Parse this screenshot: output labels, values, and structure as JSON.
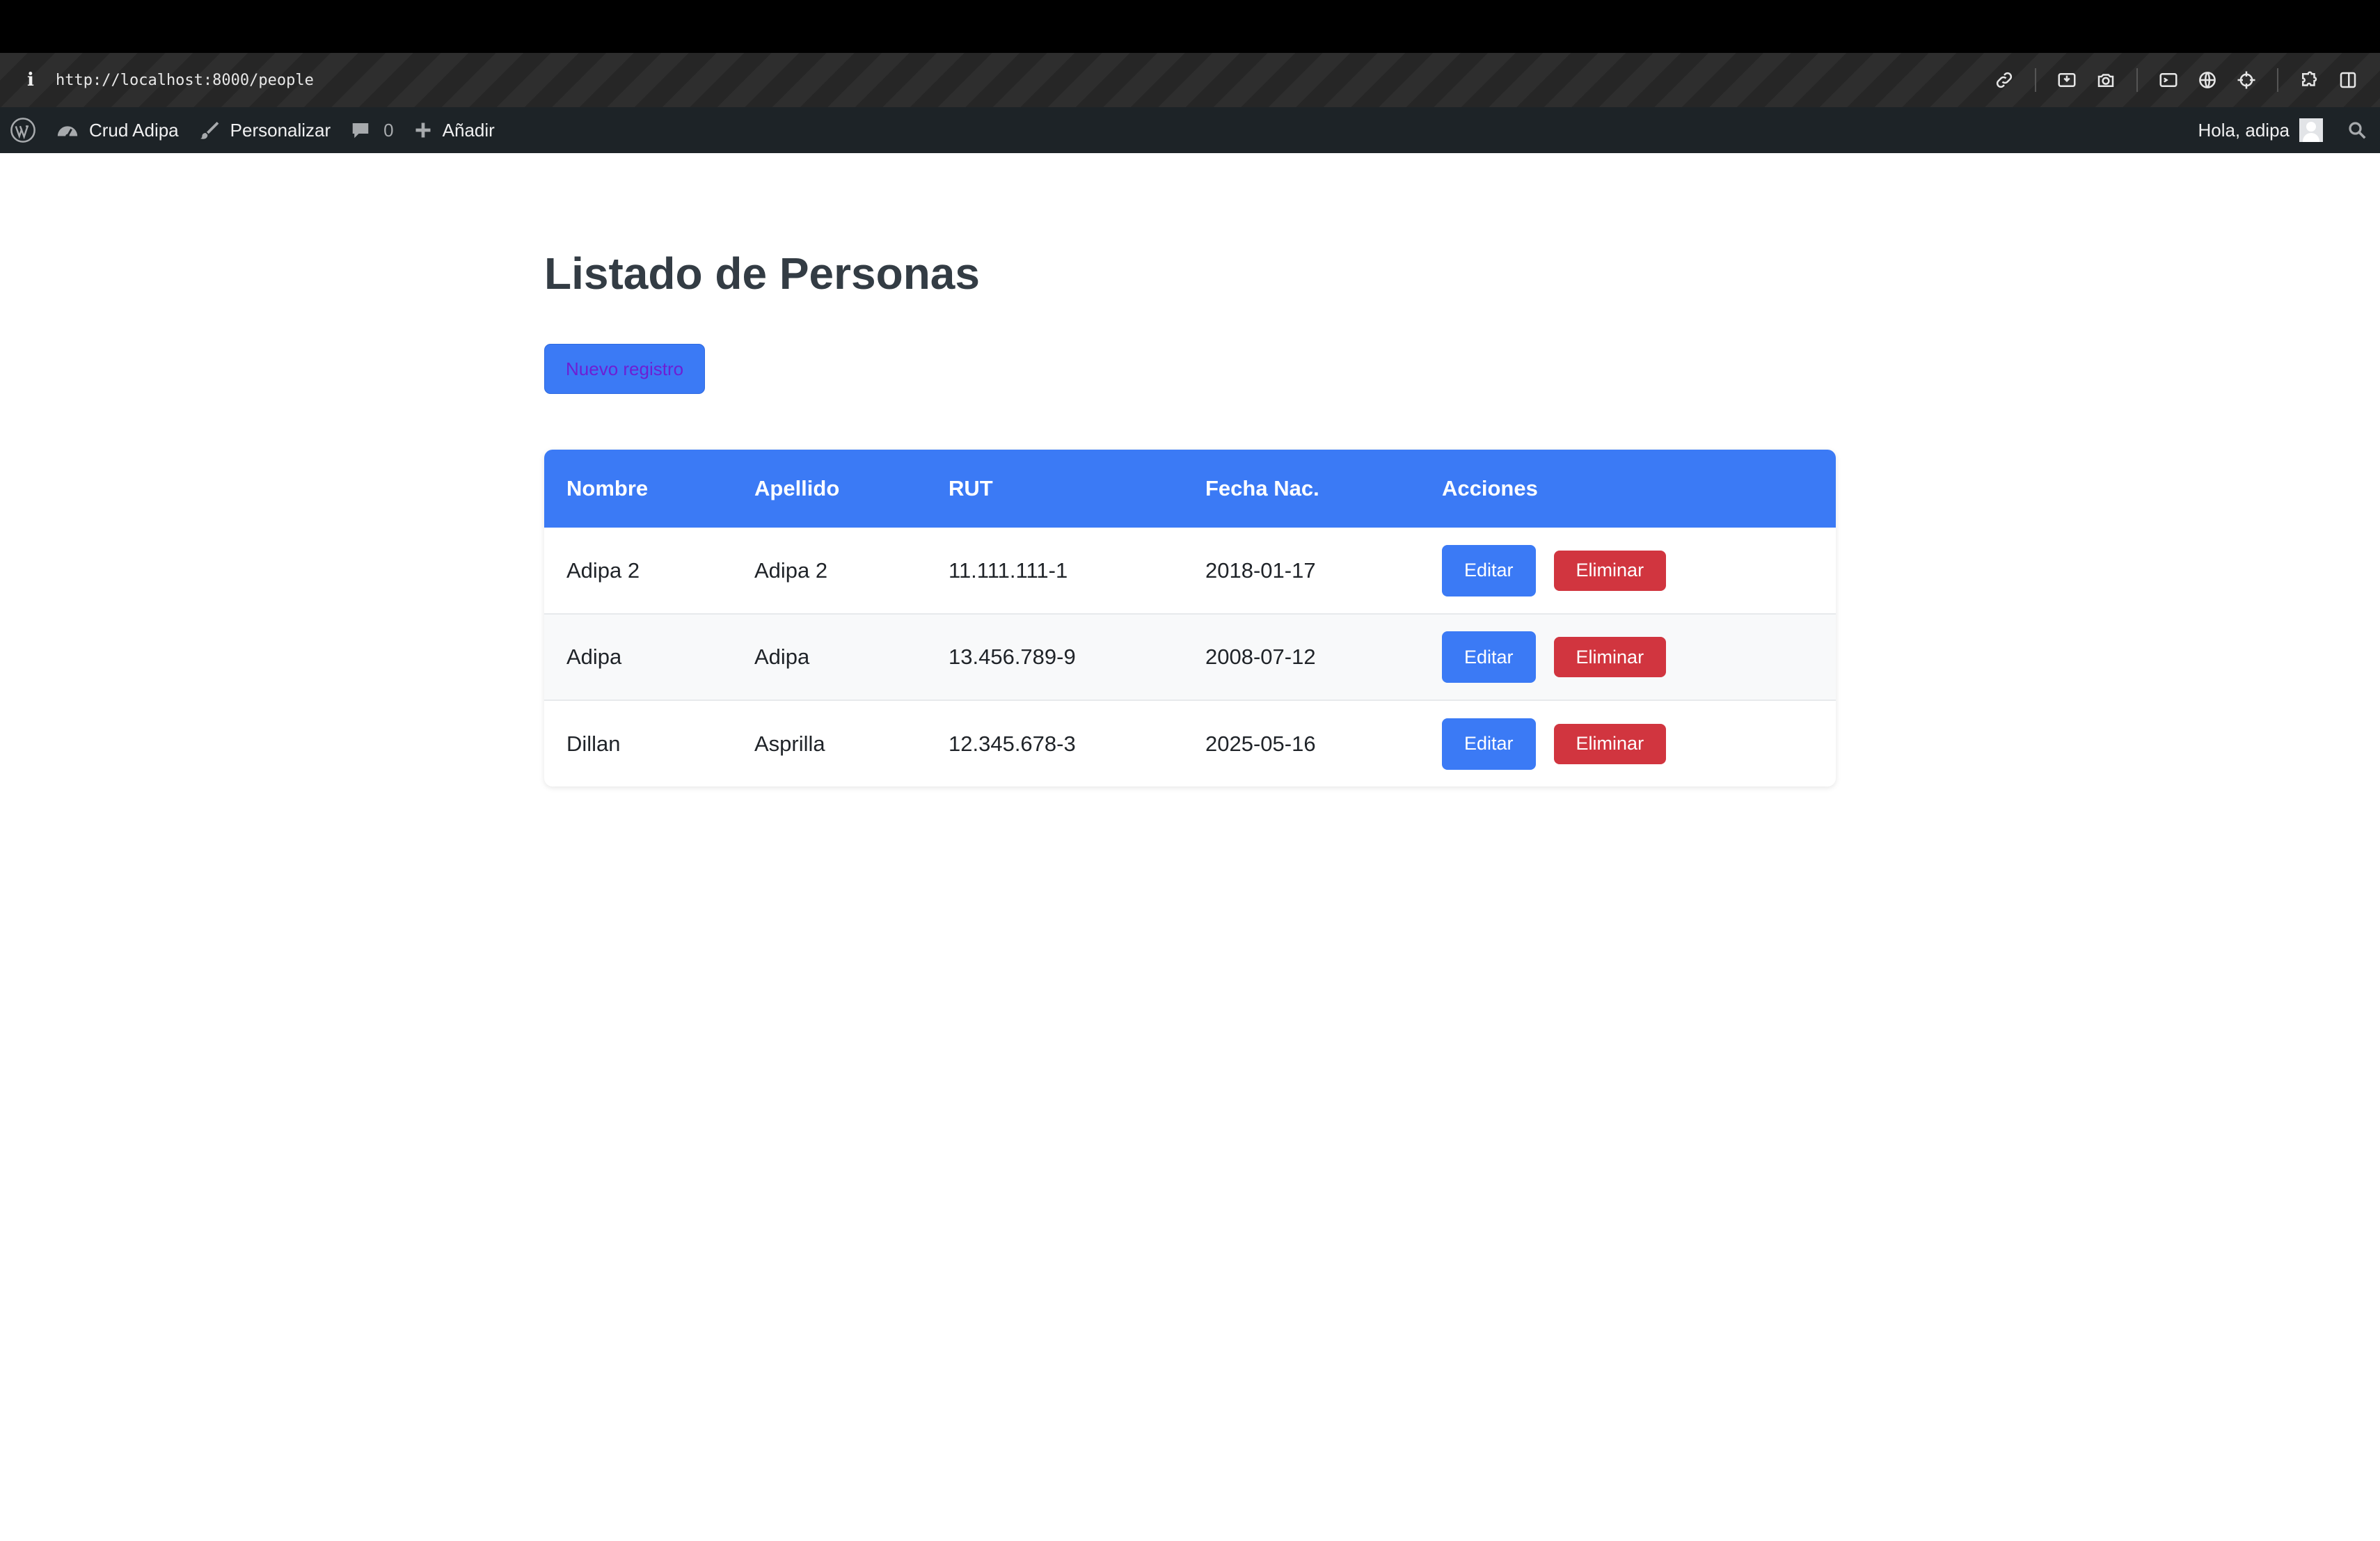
{
  "browser": {
    "url": "http://localhost:8000/people",
    "info_icon": "i",
    "toolbar_icons": [
      "link-icon",
      "screenshot-icon",
      "camera-icon",
      "console-icon",
      "globe-icon",
      "crosshair-icon",
      "extension-icon",
      "sidebar-icon"
    ]
  },
  "adminbar": {
    "site_name": "Crud Adipa",
    "customize_label": "Personalizar",
    "comments_count": "0",
    "new_label": "Añadir",
    "greeting": "Hola, adipa"
  },
  "page": {
    "title": "Listado de Personas",
    "new_button": "Nuevo registro"
  },
  "table": {
    "headers": [
      "Nombre",
      "Apellido",
      "RUT",
      "Fecha Nac.",
      "Acciones"
    ],
    "rows": [
      {
        "nombre": "Adipa 2",
        "apellido": "Adipa 2",
        "rut": "11.111.111-1",
        "fecha": "2018-01-17",
        "edit": "Editar",
        "delete": "Eliminar"
      },
      {
        "nombre": "Adipa",
        "apellido": "Adipa",
        "rut": "13.456.789-9",
        "fecha": "2008-07-12",
        "edit": "Editar",
        "delete": "Eliminar"
      },
      {
        "nombre": "Dillan",
        "apellido": "Asprilla",
        "rut": "12.345.678-3",
        "fecha": "2025-05-16",
        "edit": "Editar",
        "delete": "Eliminar"
      }
    ]
  },
  "colors": {
    "primary": "#3b7af5",
    "danger": "#d1353f",
    "adminbar": "#1d2327"
  }
}
